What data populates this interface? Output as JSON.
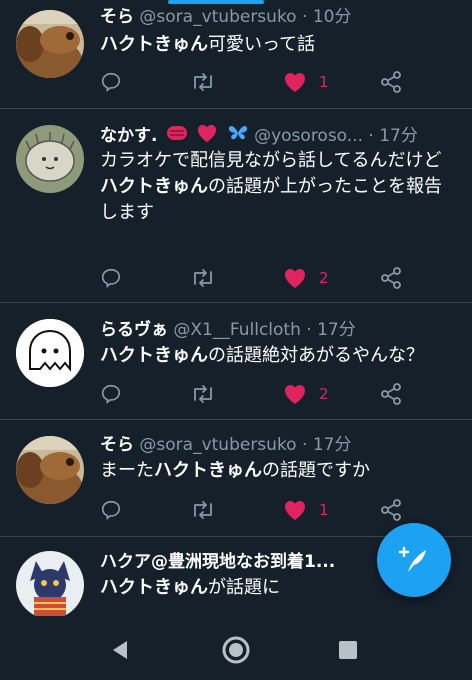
{
  "tweets": [
    {
      "name": "そら",
      "handle": "@sora_vtubersuko",
      "time": "10分",
      "segments": [
        {
          "text": "ハクトきゅん",
          "bold": true
        },
        {
          "text": "可愛いって話",
          "bold": false
        }
      ],
      "like_count": "1",
      "avatar": "dog-photo"
    },
    {
      "name": "なかす.",
      "handle": "@yosoroso...",
      "time": "17分",
      "emoji": [
        "red-circle-icon",
        "red-heart-icon",
        "blue-butterfly-icon"
      ],
      "segments": [
        {
          "text": "カラオケで配信見ながら話してるんだけど",
          "bold": false
        },
        {
          "text": "\n",
          "bold": false
        },
        {
          "text": "ハクトきゅん",
          "bold": true
        },
        {
          "text": "の話題が上がったことを報告します",
          "bold": false
        }
      ],
      "like_count": "2",
      "avatar": "hedgehog-drawing"
    },
    {
      "name": "らるヴぁ",
      "handle": "@X1__Fullcloth",
      "time": "17分",
      "segments": [
        {
          "text": "ハクトきゅん",
          "bold": true
        },
        {
          "text": "の話題絶対あがるやんな？",
          "bold": false
        }
      ],
      "like_count": "2",
      "avatar": "ghost-drawing"
    },
    {
      "name": "そら",
      "handle": "@sora_vtubersuko",
      "time": "17分",
      "segments": [
        {
          "text": "まーた",
          "bold": false
        },
        {
          "text": "ハクトきゅん",
          "bold": true
        },
        {
          "text": "の話題ですか",
          "bold": false
        }
      ],
      "like_count": "1",
      "avatar": "dog-photo"
    },
    {
      "name": "ハクア@豊洲現地なお到着1...",
      "handle": "",
      "time": "",
      "segments": [
        {
          "text": "ハクトきゅん",
          "bold": true
        },
        {
          "text": "が話題に",
          "bold": false
        }
      ],
      "like_count": "",
      "avatar": "anime-character"
    }
  ],
  "dot": "·",
  "fab": {
    "icon": "compose-feather-icon"
  },
  "nav": [
    "back-icon",
    "home-icon",
    "recents-icon"
  ],
  "colors": {
    "background": "#15202b",
    "accent": "#1da1f2",
    "like": "#e0245e",
    "muted": "#8899a6",
    "divider": "#38444d"
  }
}
